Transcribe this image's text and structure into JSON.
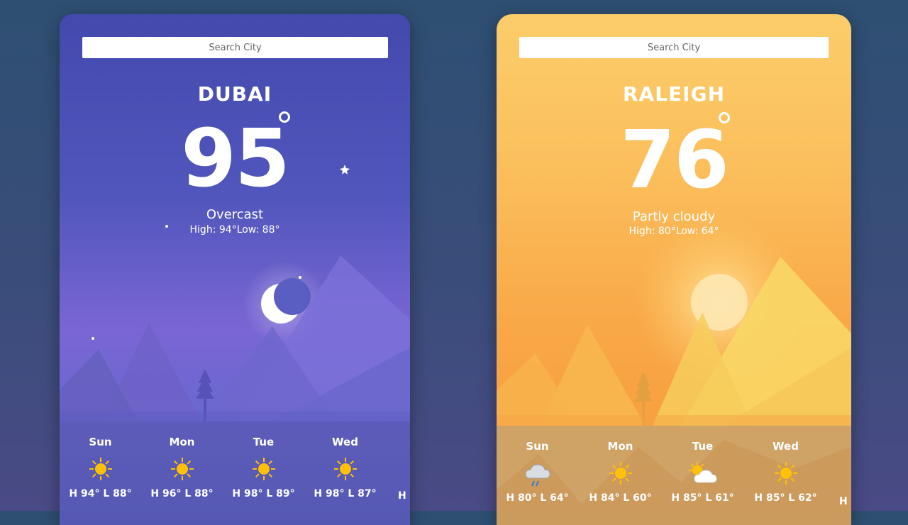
{
  "cards": [
    {
      "search_placeholder": "Search City",
      "city": "DUBAI",
      "temperature": "95",
      "condition": "Overcast",
      "high": "High: 94°",
      "low": "Low: 88°",
      "theme": "night",
      "forecast": [
        {
          "day": "Sun",
          "hilo": "H 94°  L 88°",
          "icon": "sun-icon"
        },
        {
          "day": "Mon",
          "hilo": "H 96°  L 88°",
          "icon": "sun-icon"
        },
        {
          "day": "Tue",
          "hilo": "H 98°  L 89°",
          "icon": "sun-icon"
        },
        {
          "day": "Wed",
          "hilo": "H 98°  L 87°",
          "icon": "sun-icon"
        },
        {
          "day": "",
          "hilo": "H",
          "icon": ""
        }
      ]
    },
    {
      "search_placeholder": "Search City",
      "city": "RALEIGH",
      "temperature": "76",
      "condition": "Partly cloudy",
      "high": "High: 80°",
      "low": "Low: 64°",
      "theme": "day",
      "forecast": [
        {
          "day": "Sun",
          "hilo": "H 80°  L 64°",
          "icon": "rain-cloud-icon"
        },
        {
          "day": "Mon",
          "hilo": "H 84°  L 60°",
          "icon": "sun-icon"
        },
        {
          "day": "Tue",
          "hilo": "H 85°  L 61°",
          "icon": "partly-cloudy-icon"
        },
        {
          "day": "Wed",
          "hilo": "H 85°  L 62°",
          "icon": "sun-icon"
        },
        {
          "day": "",
          "hilo": "H",
          "icon": ""
        }
      ]
    }
  ],
  "colors": {
    "background": "#34507a",
    "night_card": "#4349ad",
    "day_card": "#fbc35e",
    "sun_icon": "#ffc107"
  }
}
